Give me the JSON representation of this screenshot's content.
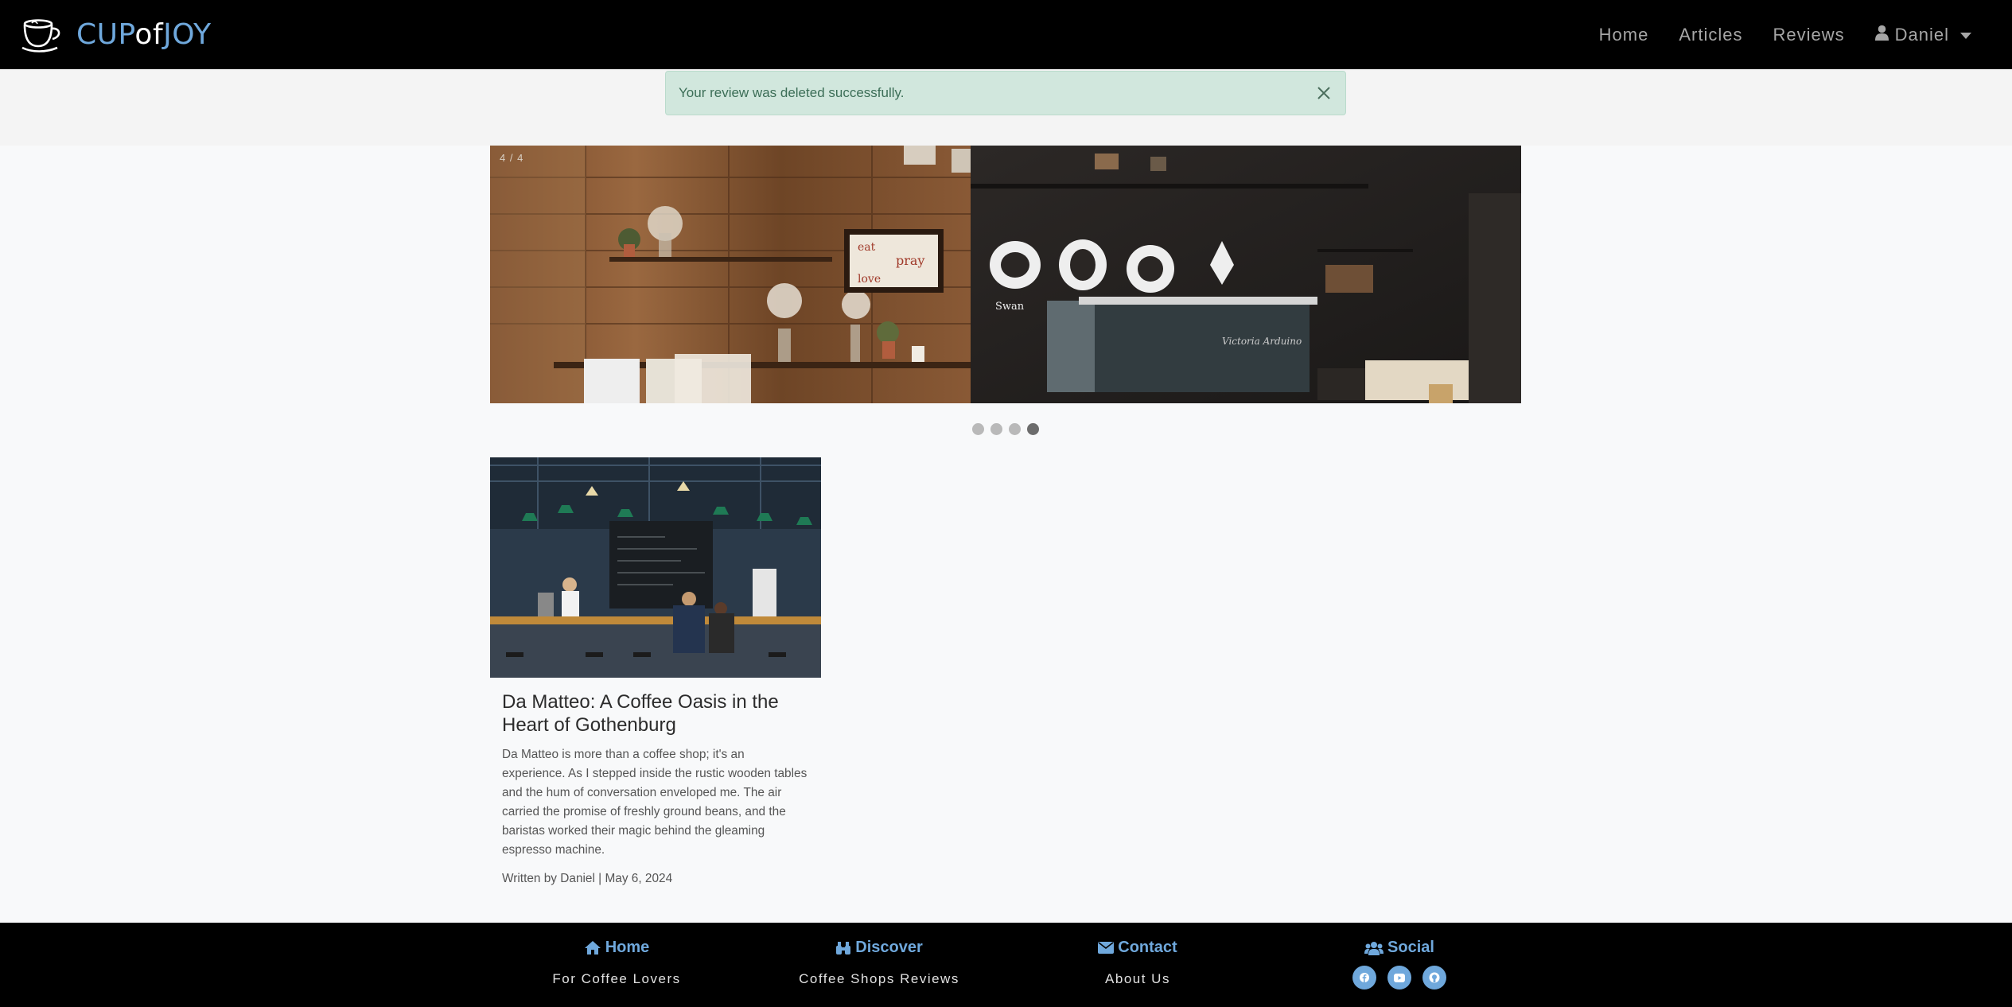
{
  "navbar": {
    "brand_part1": "CUP",
    "brand_part2": "of",
    "brand_part3": "JOY",
    "brand_icon": "coffee-cup-icon",
    "links": [
      {
        "label": "Home"
      },
      {
        "label": "Articles"
      },
      {
        "label": "Reviews"
      }
    ],
    "user": {
      "label": "Daniel",
      "icon": "user-icon"
    }
  },
  "alert": {
    "message": "Your review was deleted successfully.",
    "close_icon": "close-icon"
  },
  "carousel": {
    "counter": "4 / 4",
    "slide_count": 4,
    "active_index": 3
  },
  "article": {
    "title": "Da Matteo: A Coffee Oasis in the Heart of Gothenburg",
    "excerpt": "Da Matteo is more than a coffee shop; it's an experience. As I stepped inside the rustic wooden tables and the hum of conversation enveloped me. The air carried the promise of freshly ground beans, and the baristas worked their magic behind the gleaming espresso machine.",
    "meta": "Written by Daniel | May 6, 2024"
  },
  "footer": {
    "columns": [
      {
        "heading": "Home",
        "icon": "home-icon",
        "sub": "For Coffee Lovers"
      },
      {
        "heading": "Discover",
        "icon": "binoculars-icon",
        "sub": "Coffee Shops Reviews"
      },
      {
        "heading": "Contact",
        "icon": "envelope-icon",
        "sub": "About Us"
      },
      {
        "heading": "Social",
        "icon": "users-icon",
        "socials": [
          "facebook-icon",
          "youtube-icon",
          "github-icon"
        ]
      }
    ]
  },
  "colors": {
    "accent": "#6fa8dc",
    "alert_bg": "#d1e7dd",
    "alert_text": "#3c6e57",
    "navbar_bg": "#000000"
  }
}
